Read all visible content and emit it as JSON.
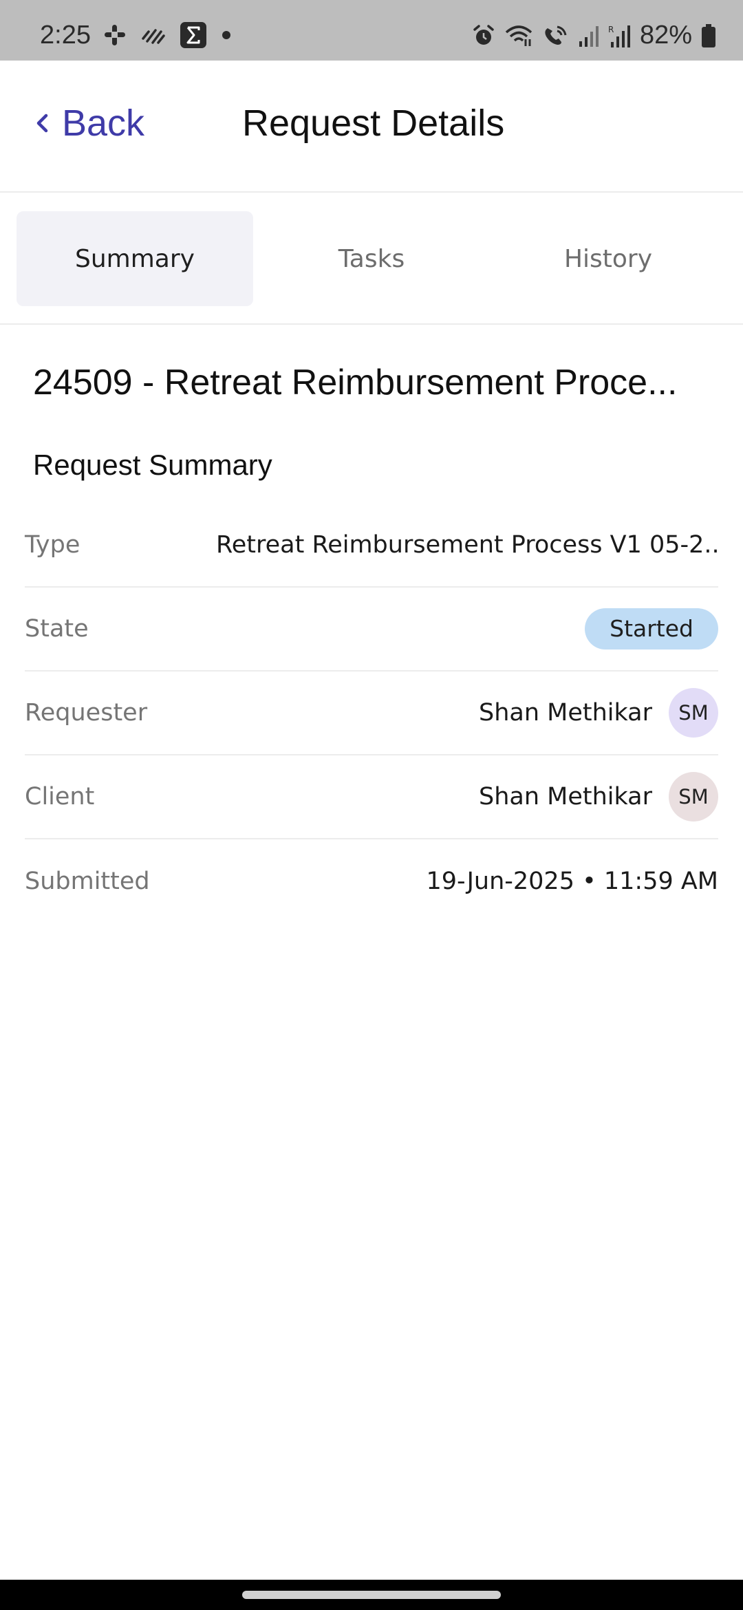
{
  "status_bar": {
    "time": "2:25",
    "battery": "82%",
    "left_icons": [
      "slack-icon",
      "activity-icon",
      "sigma-app-icon",
      "dot-icon"
    ],
    "right_icons": [
      "alarm-icon",
      "wifi-icon",
      "wifi-call-icon",
      "signal-icon",
      "signal-r-icon",
      "battery-icon"
    ]
  },
  "header": {
    "back_label": "Back",
    "title": "Request Details",
    "accent_color": "#3f3ba8"
  },
  "tabs": [
    {
      "label": "Summary",
      "active": true
    },
    {
      "label": "Tasks",
      "active": false
    },
    {
      "label": "History",
      "active": false
    }
  ],
  "request": {
    "title": "24509 - Retreat Reimbursement Proce...",
    "section_title": "Request Summary",
    "rows": {
      "type": {
        "label": "Type",
        "value": "Retreat Reimbursement Process V1 05-2..."
      },
      "state": {
        "label": "State",
        "value": "Started",
        "badge_color": "#bfdcf5"
      },
      "requester": {
        "label": "Requester",
        "name": "Shan Methikar",
        "initials": "SM",
        "avatar_color": "#e2dcf7"
      },
      "client": {
        "label": "Client",
        "name": "Shan Methikar",
        "initials": "SM",
        "avatar_color": "#eadfe0"
      },
      "submitted": {
        "label": "Submitted",
        "value": "19-Jun-2025 • 11:59 AM"
      }
    }
  }
}
